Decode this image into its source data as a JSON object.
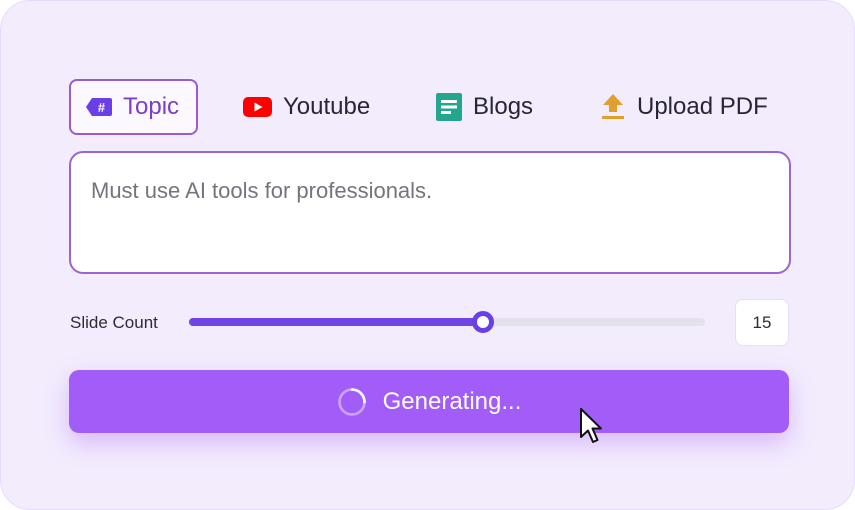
{
  "tabs": [
    {
      "label": "Topic",
      "icon": "hashtag-tag-icon",
      "active": true
    },
    {
      "label": "Youtube",
      "icon": "youtube-icon",
      "active": false
    },
    {
      "label": "Blogs",
      "icon": "document-icon",
      "active": false
    },
    {
      "label": "Upload PDF",
      "icon": "upload-icon",
      "active": false
    }
  ],
  "topic_input": {
    "placeholder": "Must use AI tools for professionals."
  },
  "slide_count": {
    "label": "Slide Count",
    "value": "15",
    "slider_fraction": 0.57
  },
  "generate_button": {
    "label": "Generating...",
    "state": "loading"
  },
  "colors": {
    "accent": "#9b5ad0",
    "slider": "#6f45e8",
    "button": "#a25cf7",
    "youtube": "#ff0000",
    "blogs": "#23a58e",
    "upload": "#e0a02c"
  }
}
